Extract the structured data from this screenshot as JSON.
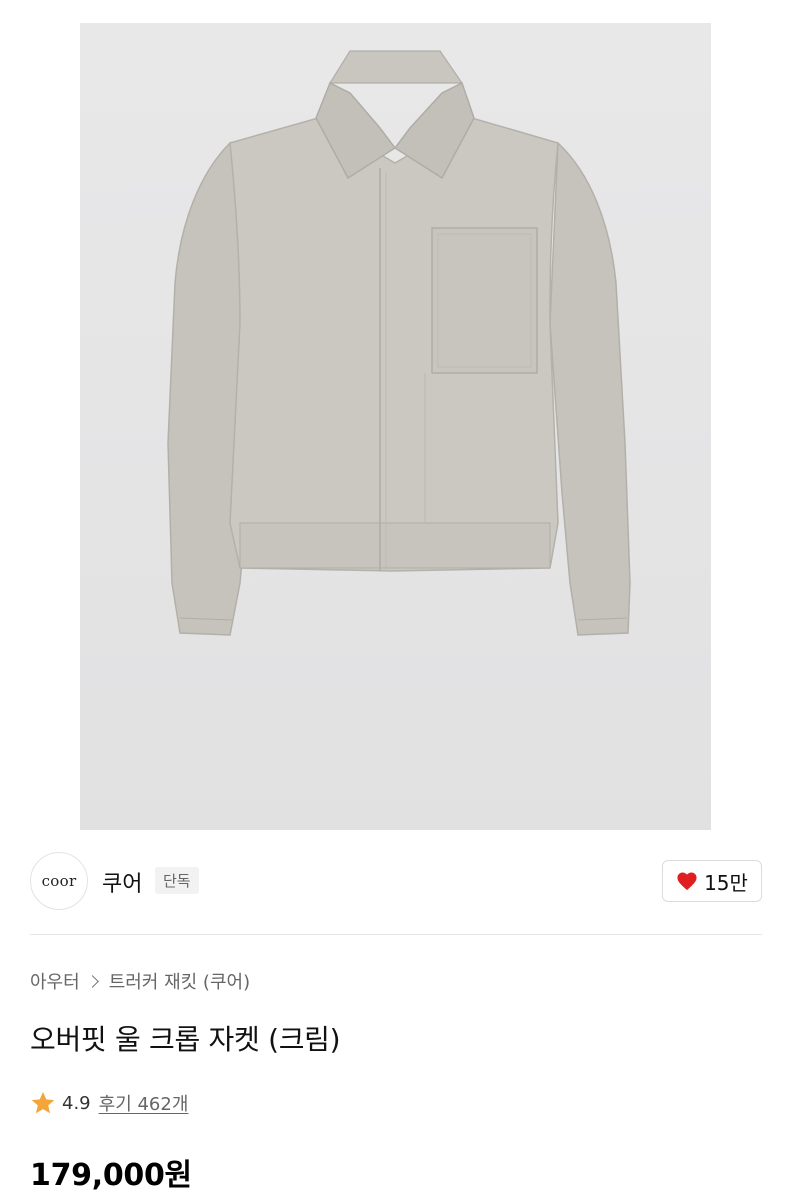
{
  "product_image": {
    "icon": "jacket-photo"
  },
  "brand": {
    "logo_text": "coor",
    "name": "쿠어",
    "badge": "단독"
  },
  "like": {
    "icon": "heart-icon",
    "count": "15만",
    "color": "#e02020"
  },
  "breadcrumb": {
    "category": "아우터",
    "subcategory": "트러커 재킷 (쿠어)"
  },
  "product": {
    "title": "오버핏 울 크롭 자켓 (크림)",
    "rating": "4.9",
    "reviews": "후기 462개",
    "price": "179,000원"
  },
  "colors": {
    "star": "#f4a53a",
    "heart": "#e02020"
  }
}
